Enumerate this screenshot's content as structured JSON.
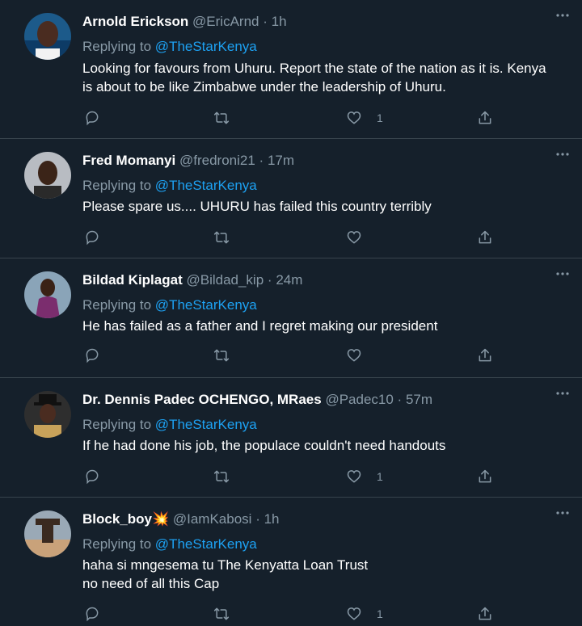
{
  "reply_prefix": "Replying to",
  "tweets": [
    {
      "name": "Arnold Erickson",
      "handle": "@EricArnd",
      "time": "1h",
      "mention": "@TheStarKenya",
      "lines": [
        "Looking for favours from Uhuru. Report the state of the nation as it is. Kenya",
        "is about to be like Zimbabwe under the leadership of Uhuru."
      ],
      "likes": "1"
    },
    {
      "name": "Fred Momanyi",
      "handle": "@fredroni21",
      "time": "17m",
      "mention": "@TheStarKenya",
      "lines": [
        "Please spare us.... UHURU has failed this country terribly"
      ],
      "likes": ""
    },
    {
      "name": "Bildad Kiplagat",
      "handle": "@Bildad_kip",
      "time": "24m",
      "mention": "@TheStarKenya",
      "lines": [
        "He has failed as a father and I regret making our president"
      ],
      "likes": ""
    },
    {
      "name": "Dr. Dennis Padec OCHENGO, MRaes",
      "handle": "@Padec10",
      "time": "57m",
      "mention": "@TheStarKenya",
      "lines": [
        "If he had done his job, the populace couldn't need handouts"
      ],
      "likes": "1"
    },
    {
      "name": "Block_boy💥",
      "handle": "@IamKabosi",
      "time": "1h",
      "mention": "@TheStarKenya",
      "lines": [
        "haha si mngesema tu The Kenyatta Loan Trust",
        "no need of all this Cap"
      ],
      "likes": "1"
    }
  ],
  "colors": {
    "background": "#15202b",
    "divider": "#38444d",
    "secondary_text": "#8899a6",
    "accent": "#1da1f2"
  },
  "icons": {
    "reply": "reply-icon",
    "retweet": "retweet-icon",
    "like": "like-icon",
    "share": "share-icon",
    "more": "more-icon"
  }
}
